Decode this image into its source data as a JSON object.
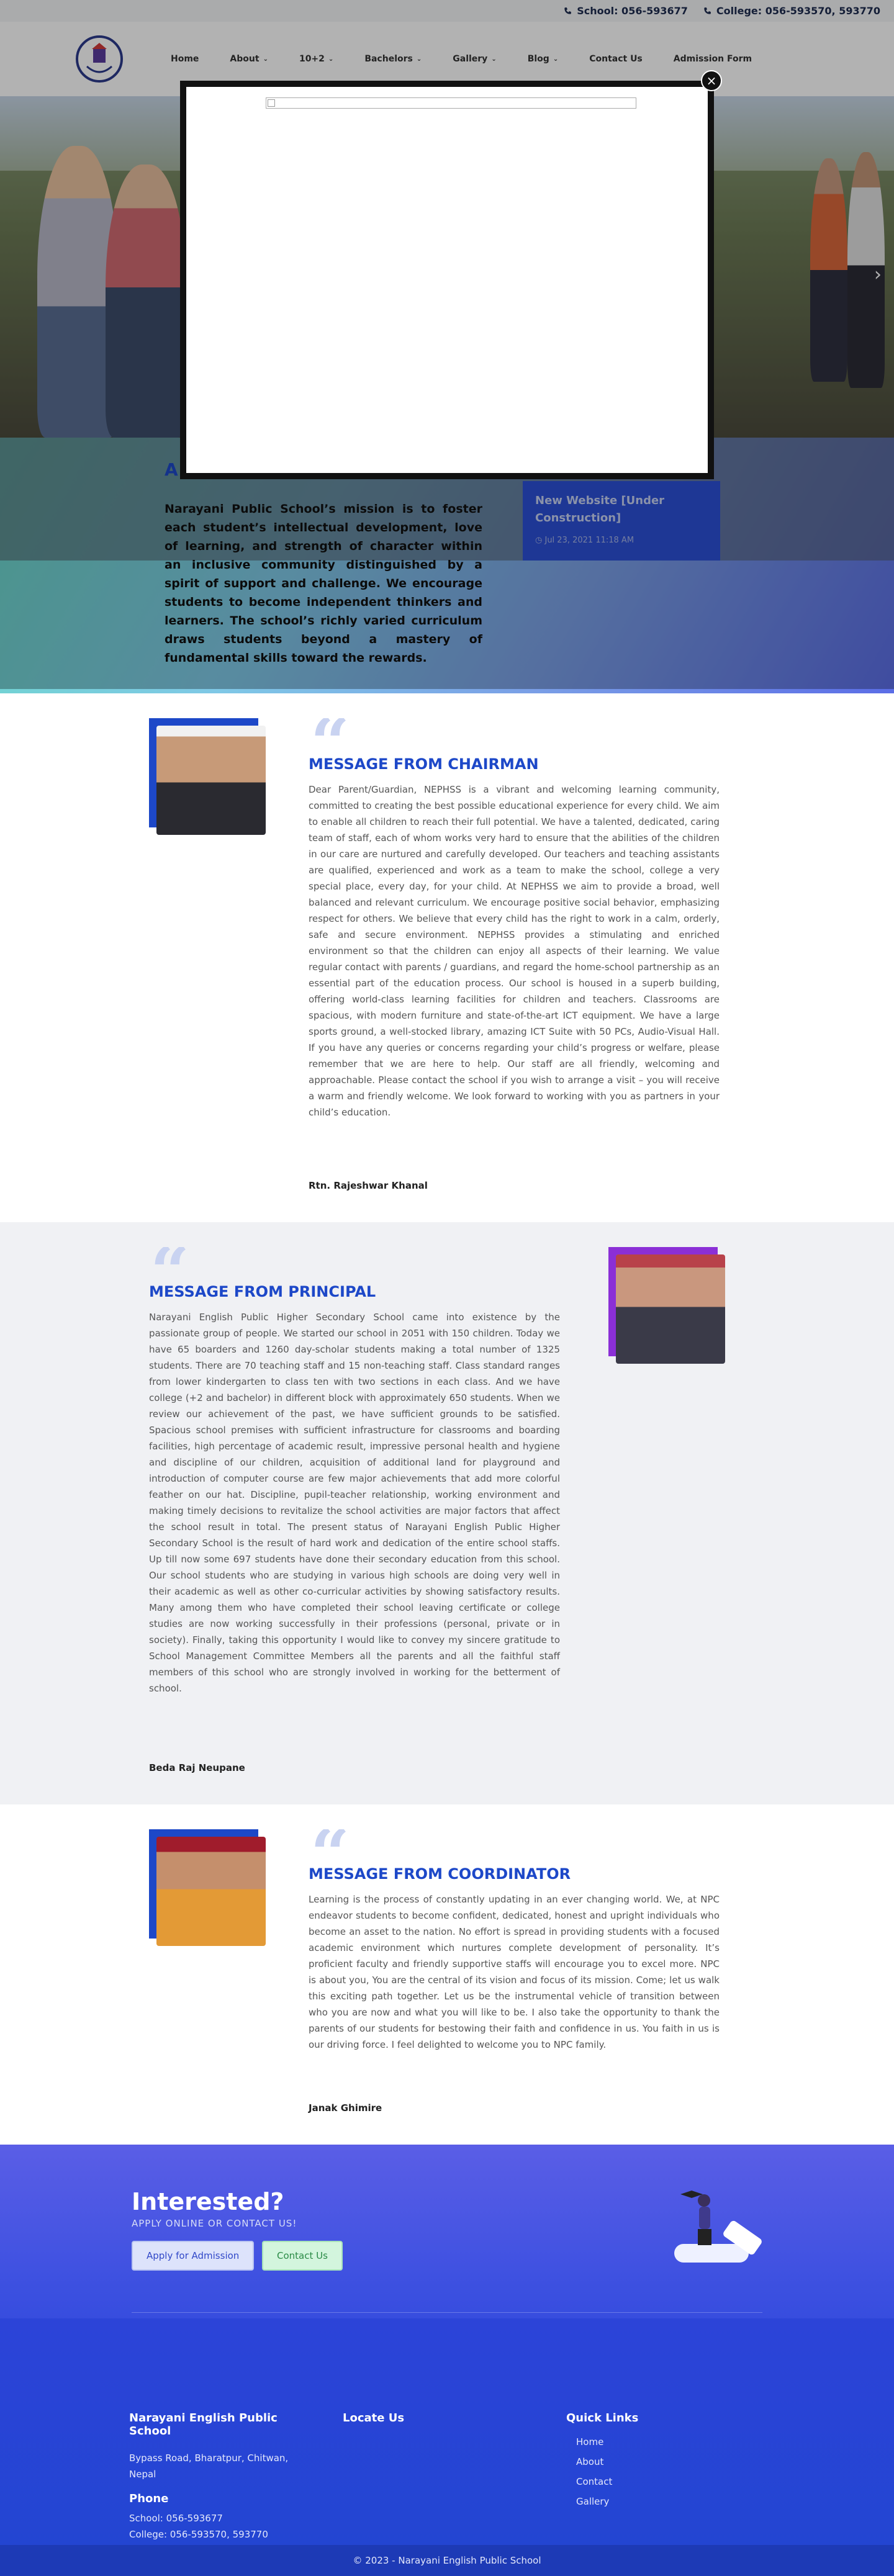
{
  "topbar": {
    "school_phone": "School: 056-593677",
    "college_phone": "College: 056-593570, 593770"
  },
  "nav": {
    "items": [
      {
        "label": "Home",
        "dropdown": false
      },
      {
        "label": "About",
        "dropdown": true
      },
      {
        "label": "10+2",
        "dropdown": true
      },
      {
        "label": "Bachelors",
        "dropdown": true
      },
      {
        "label": "Gallery",
        "dropdown": true
      },
      {
        "label": "Blog",
        "dropdown": true
      },
      {
        "label": "Contact Us",
        "dropdown": false
      },
      {
        "label": "Admission Form",
        "dropdown": false
      }
    ]
  },
  "intro": {
    "title": "A",
    "mission": "Narayani Public School’s mission is to foster each student’s intellectual development, love of learning, and strength of character within an inclusive community distinguished by a spirit of support and challenge. We encourage students to become independent thinkers and learners. The school’s richly varied curriculum draws students beyond a mastery of fundamental skills toward the rewards.",
    "news_title": "New Website [Under Construction]",
    "news_date": "Jul 23, 2021 11:18 AM"
  },
  "chairman": {
    "heading": "MESSAGE FROM CHAIRMAN",
    "body": "Dear Parent/Guardian, NEPHSS is a vibrant and welcoming learning community, committed to creating the best possible educational experience for every child. We aim to enable all children to reach their full potential. We have a talented, dedicated, caring team of staff, each of whom works very hard to ensure that the abilities of the children in our care are nurtured and carefully developed. Our teachers and teaching assistants are qualified, experienced and work as a team to make the school, college a very special place, every day, for your child. At NEPHSS we aim to provide a broad, well balanced and relevant curriculum. We encourage positive social behavior, emphasizing respect for others. We believe that every child has the right to work in a calm, orderly, safe and secure environment. NEPHSS provides a stimulating and enriched environment so that the children can enjoy all aspects of their learning. We value regular contact with parents / guardians, and regard the home-school partnership as an essential part of the education process. Our school is housed in a superb building, offering world-class learning facilities for children and teachers. Classrooms are spacious, with modern furniture and state-of-the-art ICT equipment. We have a large sports ground, a well-stocked library, amazing ICT Suite with 50 PCs, Audio-Visual Hall. If you have any queries or concerns regarding your child’s progress or welfare, please remember that we are here to help. Our staff are all friendly, welcoming and approachable. Please contact the school if you wish to arrange a visit – you will receive a warm and friendly welcome. We look forward to working with you as partners in your child’s education.",
    "name": "Rtn. Rajeshwar Khanal"
  },
  "principal": {
    "heading": "MESSAGE FROM PRINCIPAL",
    "body": "Narayani English Public Higher Secondary School came into existence by the passionate group of people. We started our school in 2051 with 150 children. Today we have 65 boarders and 1260 day-scholar students making a total number of 1325 students. There are 70 teaching staff and 15 non-teaching staff. Class standard ranges from lower kindergarten to class ten with two sections in each class. And we have college (+2 and bachelor) in different block with approximately 650 students. When we review our achievement of the past, we have sufficient grounds to be satisfied. Spacious school premises with sufficient infrastructure for classrooms and boarding facilities, high percentage of academic result, impressive personal health and hygiene and discipline of our children, acquisition of additional land for playground and introduction of computer course are few major achievements that add more colorful feather on our hat. Discipline, pupil-teacher relationship, working environment and making timely decisions to revitalize the school activities are major factors that affect the school result in total. The present status of Narayani English Public Higher Secondary School is the result of hard work and dedication of the entire school staffs. Up till now some 697 students have done their secondary education from this school. Our school students who are studying in various high schools are doing very well in their academic as well as other co-curricular activities by showing satisfactory results. Many among them who have completed their school leaving certificate or college studies are now working successfully in their professions (personal, private or in society). Finally, taking this opportunity I would like to convey my sincere gratitude to School Management Committee Members all the parents and all the faithful staff members of this school who are strongly involved in working for the betterment of school.",
    "name": "Beda Raj Neupane"
  },
  "coordinator": {
    "heading": "MESSAGE FROM COORDINATOR",
    "body": "Learning is the process of constantly updating in an ever changing world. We, at NPC endeavor students to become confident, dedicated, honest and upright individuals who become an asset to the nation. No effort is spread in providing students with a focused academic environment which nurtures complete development of personality. It’s proficient faculty and friendly supportive staffs will encourage you to excel more. NPC is about you, You are the central of its vision and focus of its mission. Come; let us walk this exciting path together. Let us be the instrumental vehicle of transition between who you are now and what you will like to be. I also take the opportunity to thank the parents of our students for bestowing their faith and confidence in us. You faith in us is our driving force. I feel delighted to welcome you to NPC family.",
    "name": "Janak Ghimire"
  },
  "cta": {
    "title": "Interested?",
    "subtitle": "APPLY ONLINE OR CONTACT US!",
    "apply_label": "Apply for Admission",
    "contact_label": "Contact Us"
  },
  "footer": {
    "school_name": "Narayani English Public School",
    "address": "Bypass Road, Bharatpur, Chitwan, Nepal",
    "phone_heading": "Phone",
    "school_phone": "School: 056-593677",
    "college_phone": "College: 056-593570, 593770",
    "locate_heading": "Locate Us",
    "quick_links_heading": "Quick Links",
    "quick_links": [
      "Home",
      "About",
      "Contact",
      "Gallery"
    ],
    "copyright": "© 2023 - Narayani English Public School"
  },
  "modal": {
    "close_label": "×"
  },
  "colors": {
    "accent": "#1d48c8",
    "cta_gradient_top": "#5a5ee6",
    "footer": "#2345d2"
  }
}
